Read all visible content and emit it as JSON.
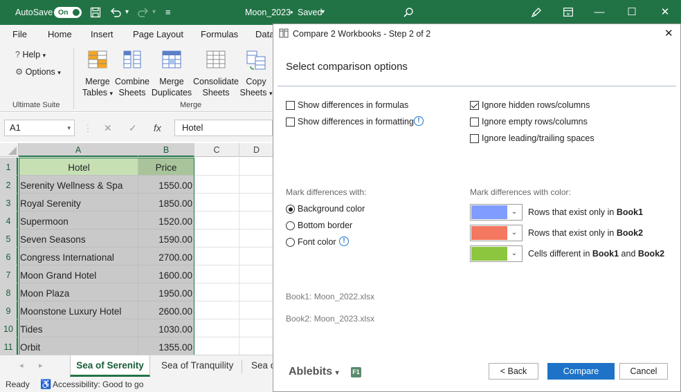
{
  "titlebar": {
    "autosave_label": "AutoSave",
    "autosave_state": "On",
    "doc_title": "Moon_2023",
    "saved_state": "Saved",
    "minimize": "—",
    "maximize": "☐",
    "close": "✕"
  },
  "ribbon": {
    "tabs": [
      "File",
      "Home",
      "Insert",
      "Page Layout",
      "Formulas",
      "Data"
    ],
    "help": "Help",
    "options": "Options",
    "group_ultimate": "Ultimate Suite",
    "group_merge": "Merge",
    "buttons": [
      {
        "line1": "Merge",
        "line2": "Tables"
      },
      {
        "line1": "Combine",
        "line2": "Sheets"
      },
      {
        "line1": "Merge",
        "line2": "Duplicates"
      },
      {
        "line1": "Consolidate",
        "line2": "Sheets"
      },
      {
        "line1": "Copy",
        "line2": "Sheets"
      }
    ]
  },
  "formula_bar": {
    "name_box": "A1",
    "cancel": "✕",
    "enter": "✓",
    "fx": "fx",
    "value": "Hotel"
  },
  "sheet": {
    "columns": [
      "A",
      "B",
      "C",
      "D"
    ],
    "headers": [
      "Hotel",
      "Price"
    ],
    "rows": [
      {
        "n": "1",
        "hotel": "Hotel",
        "price": "Price"
      },
      {
        "n": "2",
        "hotel": "Serenity Wellness & Spa",
        "price": "1550.00"
      },
      {
        "n": "3",
        "hotel": "Royal Serenity",
        "price": "1850.00"
      },
      {
        "n": "4",
        "hotel": "Supermoon",
        "price": "1520.00"
      },
      {
        "n": "5",
        "hotel": "Seven Seasons",
        "price": "1590.00"
      },
      {
        "n": "6",
        "hotel": "Congress International",
        "price": "2700.00"
      },
      {
        "n": "7",
        "hotel": "Moon Grand Hotel",
        "price": "1600.00"
      },
      {
        "n": "8",
        "hotel": "Moon Plaza",
        "price": "1950.00"
      },
      {
        "n": "9",
        "hotel": "Moonstone Luxury Hotel",
        "price": "2600.00"
      },
      {
        "n": "10",
        "hotel": "Tides",
        "price": "1030.00"
      },
      {
        "n": "11",
        "hotel": "Orbit",
        "price": "1355.00"
      }
    ],
    "tabs": [
      "Sea of Serenity",
      "Sea of Tranquility",
      "Sea o"
    ],
    "status_ready": "Ready",
    "status_accessibility": "Accessibility: Good to go"
  },
  "dialog": {
    "title": "Compare 2 Workbooks - Step 2 of 2",
    "heading": "Select comparison options",
    "options_left": [
      {
        "label": "Show differences in formulas",
        "checked": false
      },
      {
        "label": "Show differences in formatting",
        "checked": false
      }
    ],
    "options_right": [
      {
        "label": "Ignore hidden rows/columns",
        "checked": true
      },
      {
        "label": "Ignore empty rows/columns",
        "checked": false
      },
      {
        "label": "Ignore leading/trailing spaces",
        "checked": false
      }
    ],
    "mark_with_label": "Mark differences with:",
    "mark_options": [
      {
        "label": "Background color",
        "selected": true
      },
      {
        "label": "Bottom border",
        "selected": false
      },
      {
        "label": "Font color",
        "selected": false
      }
    ],
    "mark_color_label": "Mark differences with color:",
    "color_rows": [
      {
        "color": "#7f9cff",
        "text": "Rows that exist only in ",
        "b1": "Book1"
      },
      {
        "color": "#f4775f",
        "text": "Rows that exist only in ",
        "b1": "Book2"
      },
      {
        "color": "#8cc63f",
        "text": "Cells different in ",
        "b1": "Book1",
        "mid": " and ",
        "b2": "Book2"
      }
    ],
    "book1": "Book1: Moon_2022.xlsx",
    "book2": "Book2: Moon_2023.xlsx",
    "brand": "Ablebits",
    "f1": "F1",
    "back": "< Back",
    "compare": "Compare",
    "cancel": "Cancel"
  },
  "colors": {
    "excel_green": "#217346",
    "selection_gray": "#c9c9c9",
    "header_green": "#c6e0b4",
    "header_price": "#a9c49a",
    "accent_blue": "#1e73c8"
  }
}
